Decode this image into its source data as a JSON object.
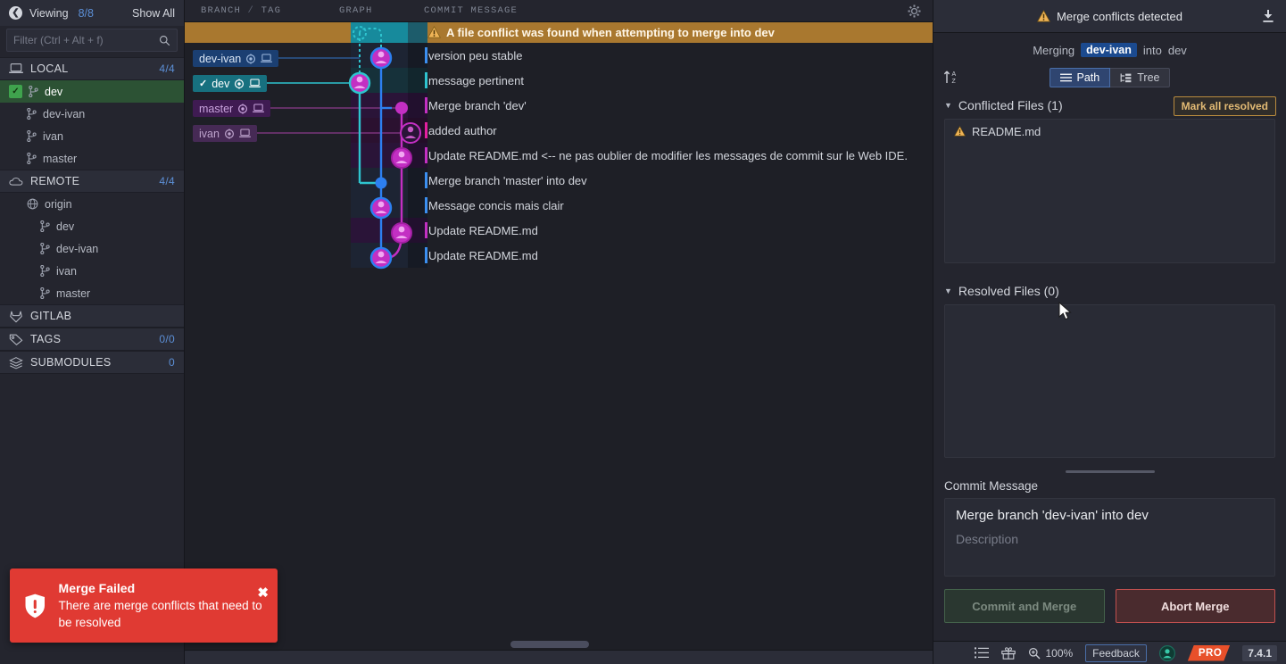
{
  "sidebar": {
    "back_icon": "back-arrow-icon",
    "viewing_label": "Viewing",
    "viewing_count": "8/8",
    "show_all": "Show All",
    "filter_placeholder": "Filter (Ctrl + Alt + f)",
    "filter_value": "",
    "sections": [
      {
        "label": "LOCAL",
        "count": "4/4",
        "icon": "laptop-icon"
      },
      {
        "label": "REMOTE",
        "count": "4/4",
        "icon": "cloud-icon"
      },
      {
        "label": "GITLAB",
        "count": "",
        "icon": "gitlab-fox-icon"
      },
      {
        "label": "TAGS",
        "count": "0/0",
        "icon": "tag-icon"
      },
      {
        "label": "SUBMODULES",
        "count": "0",
        "icon": "layers-icon"
      }
    ],
    "local_branches": [
      {
        "label": "dev",
        "active": true
      },
      {
        "label": "dev-ivan",
        "active": false
      },
      {
        "label": "ivan",
        "active": false
      },
      {
        "label": "master",
        "active": false
      }
    ],
    "remote_origin": "origin",
    "remote_branches": [
      {
        "label": "dev"
      },
      {
        "label": "dev-ivan"
      },
      {
        "label": "ivan"
      },
      {
        "label": "master"
      }
    ]
  },
  "graph": {
    "columns": {
      "branch": "BRANCH",
      "slash": "/",
      "tag": "TAG",
      "graph": "GRAPH",
      "message": "COMMIT MESSAGE"
    },
    "gear_icon": "gear-icon",
    "conflict_row": {
      "text": "A file conflict was found when attempting to merge into dev",
      "icon": "warning-triangle-icon"
    },
    "commits": [
      {
        "message": "version peu stable",
        "bar": "#3b8ff0"
      },
      {
        "message": "message pertinent",
        "bar": "#2ec4cf"
      },
      {
        "message": "Merge branch 'dev'",
        "bar": "#c32fc3"
      },
      {
        "message": "added author",
        "bar": "#e41fa0"
      },
      {
        "message": "Update README.md <-- ne pas oublier de modifier les messages de commit sur le Web IDE.",
        "bar": "#c32fc3"
      },
      {
        "message": "Merge branch 'master' into dev",
        "bar": "#3b8ff0"
      },
      {
        "message": "Message concis mais clair",
        "bar": "#3b8ff0"
      },
      {
        "message": "Update README.md",
        "bar": "#c32fc3"
      },
      {
        "message": "Update README.md",
        "bar": "#3b8ff0"
      }
    ],
    "branch_chips": [
      {
        "label": "dev-ivan",
        "checked": false,
        "bg": "#1b3f72",
        "fg": "#dce7f5"
      },
      {
        "label": "dev",
        "checked": true,
        "bg": "#17707f",
        "fg": "#ffffff"
      },
      {
        "label": "master",
        "checked": false,
        "bg": "#3f1b52",
        "fg": "#c9a3dd"
      },
      {
        "label": "ivan",
        "checked": false,
        "bg": "#462a55",
        "fg": "#bda3cc"
      }
    ]
  },
  "right_panel": {
    "header_title": "Merge conflicts detected",
    "header_icon": "warning-triangle-icon",
    "download_icon": "pull-download-icon",
    "merging_prefix": "Merging",
    "merging_source": "dev-ivan",
    "merging_mid": "into",
    "merging_target": "dev",
    "sort_icon": "sort-alpha-asc-icon",
    "view_modes": [
      {
        "label": "Path",
        "icon": "list-lines-icon",
        "selected": true
      },
      {
        "label": "Tree",
        "icon": "tree-view-icon",
        "selected": false
      }
    ],
    "conflicted_title": "Conflicted Files (1)",
    "mark_all_label": "Mark all resolved",
    "conflicted_files": [
      {
        "name": "README.md",
        "icon": "warning-triangle-icon"
      }
    ],
    "resolved_title": "Resolved Files (0)",
    "resolved_files": [],
    "commit_message_label": "Commit Message",
    "commit_summary": "Merge branch 'dev-ivan' into dev",
    "commit_description_placeholder": "Description",
    "commit_button": "Commit and Merge",
    "abort_button": "Abort Merge"
  },
  "statusbar": {
    "list_icon": "list-icon",
    "gift_icon": "gift-icon",
    "zoom_icon": "zoom-magnifier-icon",
    "zoom_level": "100%",
    "feedback": "Feedback",
    "profile_icon": "profile-avatar-icon",
    "pro_badge": "PRO",
    "version": "7.4.1"
  },
  "toast": {
    "icon": "shield-alert-icon",
    "title": "Merge Failed",
    "body": "There are merge conflicts that need to be resolved",
    "close_label": "✖"
  },
  "colors": {
    "accent_blue": "#5c8fd6",
    "warning": "#e8a33d",
    "danger": "#e03a33",
    "success": "#3fa34d",
    "pro_orange": "#e8502a"
  }
}
